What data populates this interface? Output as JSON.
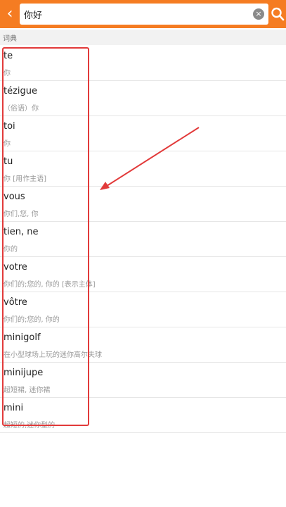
{
  "search": {
    "back_glyph": "‹",
    "query": "你好",
    "clear_glyph": "×"
  },
  "section": {
    "label": "词典"
  },
  "results": [
    {
      "word": "te",
      "meaning": "你"
    },
    {
      "word": "tézigue",
      "meaning": "（俗语）你"
    },
    {
      "word": "toi",
      "meaning": "你"
    },
    {
      "word": "tu",
      "meaning": "你 [用作主语]"
    },
    {
      "word": "vous",
      "meaning": "你们,您, 你"
    },
    {
      "word": "tien, ne",
      "meaning": "你的"
    },
    {
      "word": "votre",
      "meaning": "你们的;您的, 你的 [表示主体]"
    },
    {
      "word": "vôtre",
      "meaning": "你们的;您的, 你的"
    },
    {
      "word": "minigolf",
      "meaning": "在小型球场上玩的迷你高尔夫球"
    },
    {
      "word": "minijupe",
      "meaning": "超短裙, 迷你裙"
    },
    {
      "word": "mini",
      "meaning": "超短的,迷你型的"
    }
  ],
  "colors": {
    "accent": "#f57c22",
    "annotation": "#e23a3a"
  }
}
